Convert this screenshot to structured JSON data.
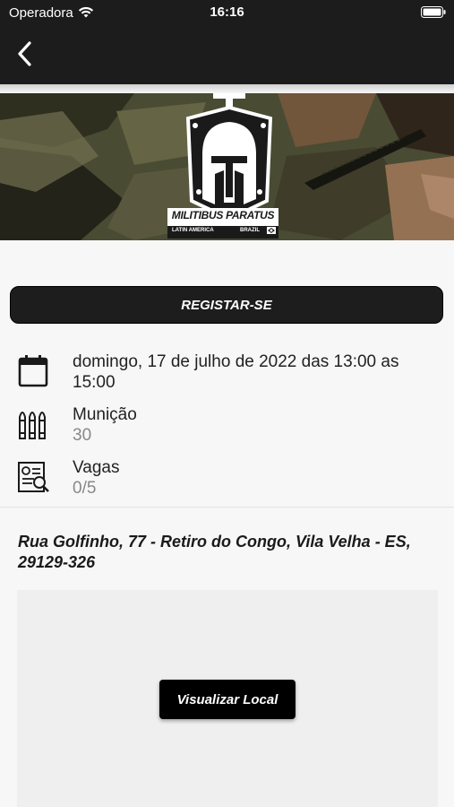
{
  "status_bar": {
    "carrier": "Operadora",
    "time": "16:16"
  },
  "nav": {
    "back_icon": "chevron-left-icon"
  },
  "banner": {
    "logo_name": "MILITIBUS PARATUS",
    "logo_left": "LATIN AMERICA",
    "logo_right": "BRAZIL",
    "icon": "spartan-helmet-shield"
  },
  "register_button": "REGISTAR-SE",
  "details": {
    "date": {
      "icon": "calendar-icon",
      "text": "domingo, 17 de julho de 2022 das 13:00 as 15:00"
    },
    "ammo": {
      "icon": "ammo-icon",
      "label": "Munição",
      "value": "30"
    },
    "slots": {
      "icon": "document-search-icon",
      "label": "Vagas",
      "value": "0/5"
    }
  },
  "address": "Rua Golfinho, 77 - Retiro do Congo, Vila Velha - ES, 29129-326",
  "map": {
    "view_button": "Visualizar Local"
  },
  "colors": {
    "dark_bar": "#1c1c1c",
    "button_bg": "#1d1d1d",
    "background": "#f7f7f7",
    "muted_text": "#888888"
  }
}
